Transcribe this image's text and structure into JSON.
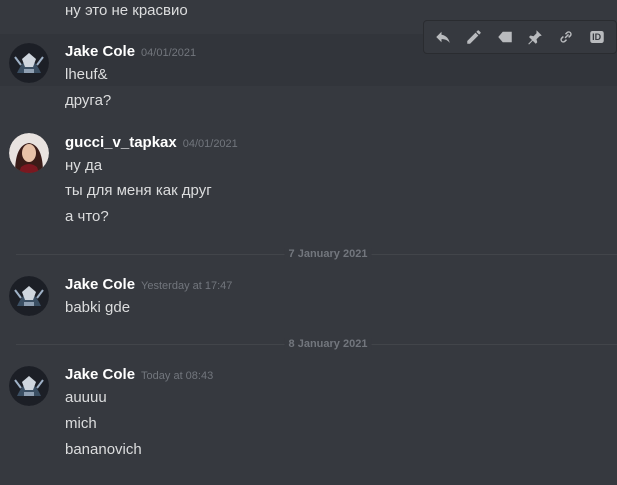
{
  "messages": {
    "prev_line": "ну это не красвио",
    "group1": {
      "author": "Jake Cole",
      "timestamp": "04/01/2021",
      "lines": [
        "lheuf&",
        "друга?"
      ]
    },
    "group2": {
      "author": "gucci_v_tapkax",
      "timestamp": "04/01/2021",
      "lines": [
        "ну да",
        "ты для меня как друг",
        "а что?"
      ]
    },
    "divider1": "7 January 2021",
    "group3": {
      "author": "Jake Cole",
      "timestamp": "Yesterday at 17:47",
      "lines": [
        "babki gde"
      ]
    },
    "divider2": "8 January 2021",
    "group4": {
      "author": "Jake Cole",
      "timestamp": "Today at 08:43",
      "lines": [
        "auuuu",
        "mich",
        "bananovich"
      ]
    }
  },
  "toolbar": {
    "icons": [
      "reply-icon",
      "edit-icon",
      "tag-icon",
      "pin-icon",
      "link-icon",
      "id-icon"
    ],
    "id_label": "ID"
  },
  "colors": {
    "background": "#36393f",
    "text": "#dcddde",
    "author": "#ffffff",
    "timestamp": "#72767d"
  }
}
